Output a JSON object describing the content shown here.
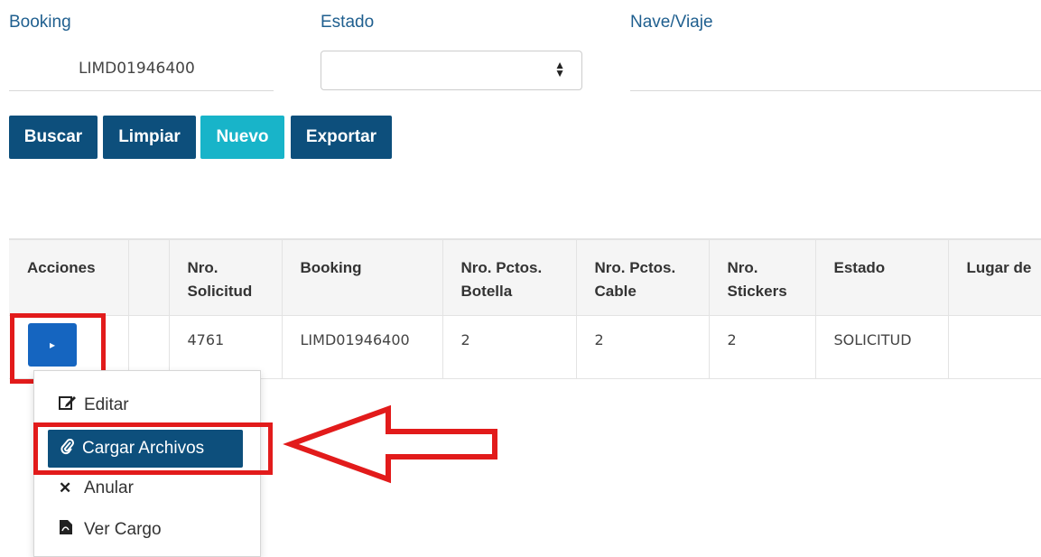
{
  "filters": {
    "booking_label": "Booking",
    "booking_value": "LIMD01946400",
    "estado_label": "Estado",
    "estado_value": "",
    "nave_label": "Nave/Viaje",
    "nave_value": ""
  },
  "buttons": {
    "buscar": "Buscar",
    "limpiar": "Limpiar",
    "nuevo": "Nuevo",
    "exportar": "Exportar"
  },
  "table": {
    "headers": [
      "Acciones",
      "",
      "Nro. Solicitud",
      "Booking",
      "Nro. Pctos. Botella",
      "Nro. Pctos. Cable",
      "Nro. Stickers",
      "Estado",
      "Lugar de"
    ],
    "rows": [
      {
        "acciones": "",
        "blank": "",
        "nro_solicitud": "4761",
        "booking": "LIMD01946400",
        "botella": "2",
        "cable": "2",
        "stickers": "2",
        "estado": "SOLICITUD",
        "lugar": ""
      }
    ]
  },
  "menu": {
    "items": [
      {
        "label": "Editar",
        "icon": "edit-icon"
      },
      {
        "label": "Cargar Archivos",
        "icon": "paperclip-icon"
      },
      {
        "label": "Anular",
        "icon": "close-icon"
      },
      {
        "label": "Ver Cargo",
        "icon": "pdf-file-icon"
      }
    ]
  },
  "colors": {
    "primary": "#0d4f7c",
    "accent": "#18b4c9",
    "highlight": "#e21b1b"
  }
}
